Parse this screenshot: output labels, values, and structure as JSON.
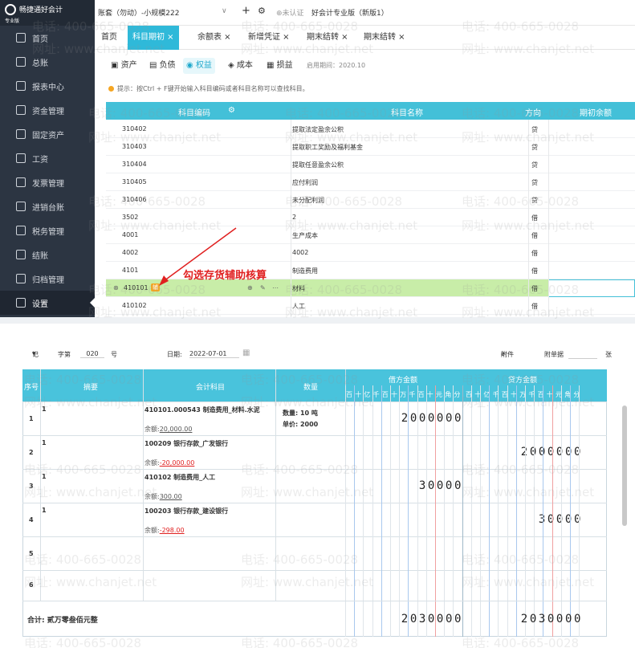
{
  "logo": {
    "name": "畅捷通好会计",
    "edition": "专业版"
  },
  "sidebar": {
    "items": [
      {
        "label": "首页",
        "icon": "home-icon"
      },
      {
        "label": "总账",
        "icon": "ledger-icon"
      },
      {
        "label": "报表中心",
        "icon": "chart-icon"
      },
      {
        "label": "资金管理",
        "icon": "money-icon"
      },
      {
        "label": "固定资产",
        "icon": "asset-icon"
      },
      {
        "label": "工资",
        "icon": "salary-icon"
      },
      {
        "label": "发票管理",
        "icon": "invoice-icon"
      },
      {
        "label": "进销台账",
        "icon": "stock-icon"
      },
      {
        "label": "税务管理",
        "icon": "tax-icon"
      },
      {
        "label": "结账",
        "icon": "close-icon"
      },
      {
        "label": "归档管理",
        "icon": "archive-icon"
      },
      {
        "label": "设置",
        "icon": "gear-icon"
      }
    ]
  },
  "topbar": {
    "account": "账套（勿动）-小规模222",
    "plus": "+",
    "cert": "未认证",
    "edition": "好会计专业版（新版1）"
  },
  "tabs": [
    {
      "label": "首页"
    },
    {
      "label": "科目期初 ×"
    },
    {
      "label": "余额表 ×"
    },
    {
      "label": "新增凭证 ×"
    },
    {
      "label": "期末结转 ×"
    },
    {
      "label": "期末结转 ×"
    }
  ],
  "subtabs": [
    {
      "label": "资产"
    },
    {
      "label": "负债"
    },
    {
      "label": "权益"
    },
    {
      "label": "成本"
    },
    {
      "label": "损益"
    }
  ],
  "period": "启用期间：2020.10",
  "hint": "提示：按Ctrl + F键开始输入科目编码或者科目名称可以查找科目。",
  "table": {
    "headers": {
      "code": "科目编码",
      "name": "科目名称",
      "dir": "方向",
      "balance": "期初余额"
    },
    "rows": [
      {
        "code": "310402",
        "name": "提取法定盈余公积",
        "dir": "贷"
      },
      {
        "code": "310403",
        "name": "提取职工奖励及福利基金",
        "dir": "贷"
      },
      {
        "code": "310404",
        "name": "提取任意盈余公积",
        "dir": "贷"
      },
      {
        "code": "310405",
        "name": "应付利润",
        "dir": "贷"
      },
      {
        "code": "310406",
        "name": "未分配利润",
        "dir": "贷"
      },
      {
        "code": "3502",
        "name": "2",
        "dir": "借"
      },
      {
        "code": "4001",
        "name": "生产成本",
        "dir": "借"
      },
      {
        "code": "4002",
        "name": "4002",
        "dir": "借"
      },
      {
        "code": "4101",
        "name": "制造费用",
        "dir": "借"
      },
      {
        "code": "410101",
        "name": "材料",
        "dir": "借",
        "badge": "辅"
      },
      {
        "code": "410102",
        "name": "人工",
        "dir": "借"
      }
    ]
  },
  "annotation": "勾选存货辅助核算",
  "voucher": {
    "type": "记",
    "no_label": "字第",
    "no": "020",
    "no_suffix": "号",
    "date_label": "日期:",
    "date": "2022-07-01",
    "attach_label": "附件",
    "attach_count_label": "附单据",
    "attach_unit": "张",
    "headers": {
      "seq": "序号",
      "summary": "摘要",
      "account": "会计科目",
      "qty": "数量",
      "debit": "借方金额",
      "credit": "贷方金额"
    },
    "digit_labels": [
      "百",
      "十",
      "亿",
      "千",
      "百",
      "十",
      "万",
      "千",
      "百",
      "十",
      "元",
      "角",
      "分"
    ],
    "rows": [
      {
        "seq": "1",
        "summary": "1",
        "account": "410101.000543 制造费用_材料.水泥",
        "balance_label": "余额:",
        "balance": "20,000.00",
        "balance_negative": false,
        "qty_label": "数量: 10 吨",
        "price_label": "单价: 2000",
        "debit": "2000000",
        "credit": ""
      },
      {
        "seq": "2",
        "summary": "1",
        "account": "100209 银行存款_广发银行",
        "balance_label": "余额:",
        "balance": "-20,000.00",
        "balance_negative": true,
        "qty_label": "",
        "price_label": "",
        "debit": "",
        "credit": "2000000"
      },
      {
        "seq": "3",
        "summary": "1",
        "account": "410102 制造费用_人工",
        "balance_label": "余额:",
        "balance": "300.00",
        "balance_negative": false,
        "qty_label": "",
        "price_label": "",
        "debit": "30000",
        "credit": ""
      },
      {
        "seq": "4",
        "summary": "1",
        "account": "100203 银行存款_建设银行",
        "balance_label": "余额:",
        "balance": "-298.00",
        "balance_negative": true,
        "qty_label": "",
        "price_label": "",
        "debit": "",
        "credit": "30000"
      },
      {
        "seq": "5",
        "summary": "",
        "account": "",
        "balance_label": "",
        "balance": "",
        "balance_negative": false,
        "qty_label": "",
        "price_label": "",
        "debit": "",
        "credit": ""
      },
      {
        "seq": "6",
        "summary": "",
        "account": "",
        "balance_label": "",
        "balance": "",
        "balance_negative": false,
        "qty_label": "",
        "price_label": "",
        "debit": "",
        "credit": ""
      }
    ],
    "total_label": "合计:  贰万零叁佰元整",
    "total_debit": "2030000",
    "total_credit": "2030000"
  },
  "watermark": {
    "phone": "电话: 400-665-0028",
    "site": "网址: www.chanjet.net"
  },
  "colors": {
    "accent": "#2fb9d9",
    "sidebar": "#2c3542",
    "highlight": "#c8eda8",
    "negative": "#e02020"
  }
}
